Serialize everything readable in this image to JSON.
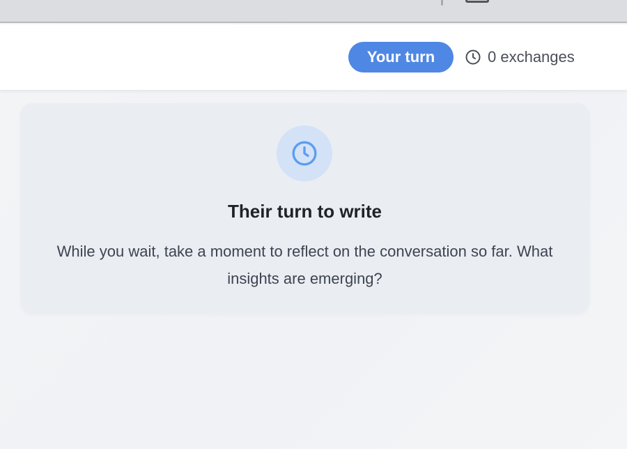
{
  "header": {
    "turn_label": "Your turn",
    "exchanges_label": "0 exchanges"
  },
  "card": {
    "title": "Their turn to write",
    "body": "While you wait, take a moment to reflect on the conversation so far. What insights are emerging?"
  },
  "colors": {
    "accent": "#4f87e4",
    "icon_bg": "#d3e2f6",
    "icon_stroke": "#5b9df0",
    "card_bg": "#eaedf2"
  },
  "icons": {
    "header": "clock-icon",
    "card": "clock-icon"
  }
}
